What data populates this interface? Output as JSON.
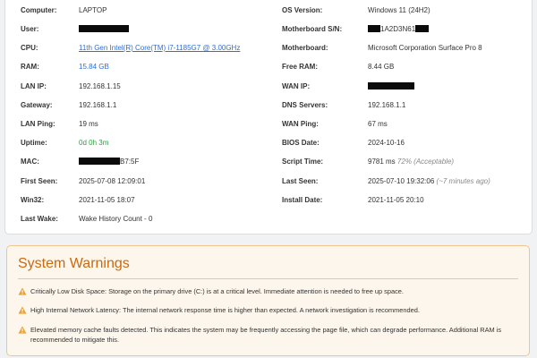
{
  "system_info": {
    "left": [
      {
        "label": "Computer:",
        "value": "LAPTOP"
      },
      {
        "label": "User:",
        "value": ""
      },
      {
        "label": "CPU:",
        "value": "11th Gen Intel(R) Core(TM) i7-1185G7 @ 3.00GHz"
      },
      {
        "label": "RAM:",
        "value": "15.84 GB"
      },
      {
        "label": "LAN IP:",
        "value": "192.168.1.15"
      },
      {
        "label": "Gateway:",
        "value": "192.168.1.1"
      },
      {
        "label": "LAN Ping:",
        "value": "19 ms"
      },
      {
        "label": "Uptime:",
        "value": "0d 0h 3m"
      },
      {
        "label": "MAC:",
        "value_suffix": "B7:5F"
      },
      {
        "label": "First Seen:",
        "value": "2025-07-08 12:09:01"
      },
      {
        "label": "Win32:",
        "value": "2021-11-05 18:07"
      },
      {
        "label": "Last Wake:",
        "value": "Wake History Count - 0"
      }
    ],
    "right": [
      {
        "label": "OS Version:",
        "value": "Windows 11 (24H2)"
      },
      {
        "label": "Motherboard S/N:",
        "value_middle": "1A2D3N61"
      },
      {
        "label": "Motherboard:",
        "value": "Microsoft Corporation Surface Pro 8"
      },
      {
        "label": "Free RAM:",
        "value": "8.44 GB"
      },
      {
        "label": "WAN IP:",
        "value": ""
      },
      {
        "label": "DNS Servers:",
        "value": "192.168.1.1"
      },
      {
        "label": "WAN Ping:",
        "value": "67 ms"
      },
      {
        "label": "BIOS Date:",
        "value": "2024-10-16"
      },
      {
        "label": "Script Time:",
        "value": "9781 ms",
        "note": "72% (Acceptable)"
      },
      {
        "label": "Last Seen:",
        "value": "2025-07-10 19:32:06",
        "note": "(~7 minutes ago)"
      },
      {
        "label": "Install Date:",
        "value": "2021-11-05 20:10"
      }
    ]
  },
  "warnings": {
    "title": "System Warnings",
    "icon": "warning-triangle-icon",
    "color": "#c96a0f",
    "items": [
      "Critically Low Disk Space: Storage on the primary drive (C:) is at a critical level. Immediate attention is needed to free up space.",
      "High Internal Network Latency: The internal network response time is higher than expected. A network investigation is recommended.",
      "Elevated memory cache faults detected. This indicates the system may be frequently accessing the page file, which can degrade performance. Additional RAM is recommended to mitigate this."
    ]
  }
}
